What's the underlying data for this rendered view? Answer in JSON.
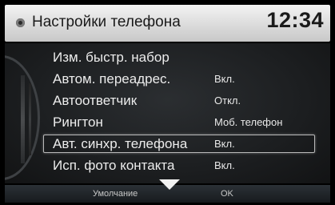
{
  "header": {
    "title": "Настройки телефона",
    "clock": "12:34",
    "icon": "phone-settings-icon"
  },
  "menu": {
    "items": [
      {
        "label": "Изм. быстр. набор",
        "value": ""
      },
      {
        "label": "Автом. переадрес.",
        "value": "Вкл."
      },
      {
        "label": "Автоответчик",
        "value": "Откл."
      },
      {
        "label": "Рингтон",
        "value": "Моб. телефон"
      },
      {
        "label": "Авт. синхр. телефона",
        "value": "Вкл.",
        "selected": true
      },
      {
        "label": "Исп. фото контакта",
        "value": "Вкл."
      }
    ]
  },
  "footer": {
    "default_label": "Умолчание",
    "ok_label": "OK",
    "scroll_icon": "scroll-down-arrow-icon"
  },
  "colors": {
    "header_bg": "#e2e2e2",
    "body_bg": "#1f2123",
    "text": "#ececec",
    "selection_border": "#b9b9b9"
  }
}
